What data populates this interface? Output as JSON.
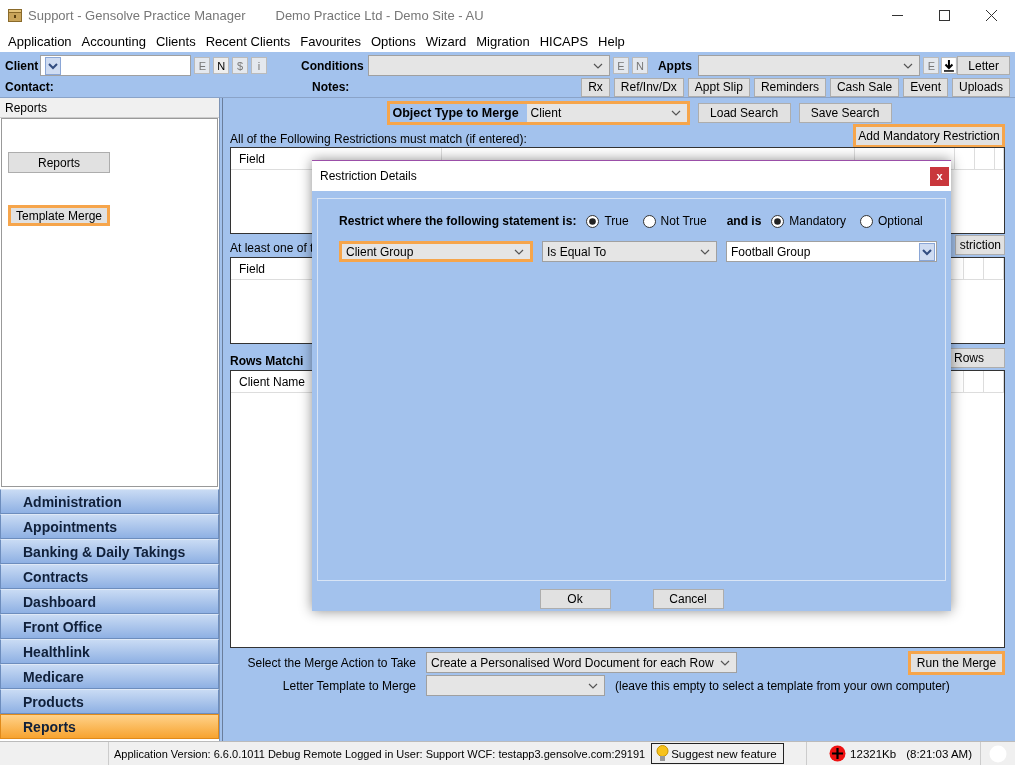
{
  "window": {
    "title": "Support - Gensolve Practice Manager",
    "subtitle": "Demo Practice Ltd - Demo Site - AU"
  },
  "menu": [
    "Application",
    "Accounting",
    "Clients",
    "Recent Clients",
    "Favourites",
    "Options",
    "Wizard",
    "Migration",
    "HICAPS",
    "Help"
  ],
  "toolbar": {
    "client_label": "Client",
    "client_buttons": [
      {
        "label": "E",
        "disabled": true
      },
      {
        "label": "N",
        "disabled": false
      },
      {
        "label": "$",
        "disabled": true
      },
      {
        "label": "i",
        "disabled": true
      }
    ],
    "conditions_label": "Conditions",
    "conditions_buttons": [
      {
        "label": "E",
        "disabled": true
      },
      {
        "label": "N",
        "disabled": true
      }
    ],
    "appts_label": "Appts",
    "appts_buttons": [
      {
        "label": "E",
        "disabled": true
      }
    ],
    "letter": "Letter",
    "contact_label": "Contact:",
    "notes_label": "Notes:",
    "actions": [
      "Rx",
      "Ref/Inv/Dx",
      "Appt Slip",
      "Reminders",
      "Cash Sale",
      "Event",
      "Uploads"
    ]
  },
  "sidebar": {
    "header": "Reports",
    "buttons": [
      {
        "label": "Reports",
        "highlighted": false
      },
      {
        "label": "Template Merge",
        "highlighted": true
      }
    ],
    "nav": [
      {
        "label": "Administration",
        "selected": false
      },
      {
        "label": "Appointments",
        "selected": false
      },
      {
        "label": "Banking & Daily Takings",
        "selected": false
      },
      {
        "label": "Contracts",
        "selected": false
      },
      {
        "label": "Dashboard",
        "selected": false
      },
      {
        "label": "Front Office",
        "selected": false
      },
      {
        "label": "Healthlink",
        "selected": false
      },
      {
        "label": "Medicare",
        "selected": false
      },
      {
        "label": "Products",
        "selected": false
      },
      {
        "label": "Reports",
        "selected": true
      }
    ]
  },
  "merge": {
    "object_type": {
      "label": "Object Type to Merge",
      "value": "Client",
      "highlighted": true
    },
    "load_search": "Load Search",
    "save_search": "Save Search",
    "add_mandatory": {
      "label": "Add Mandatory Restriction",
      "highlighted": true
    },
    "mandatory_caption": "All of the Following Restrictions must match (if entered):",
    "mandatory_columns": [
      "Field"
    ],
    "optional_caption": "At least one of t",
    "optional_button": "striction",
    "optional_columns": [
      "Field"
    ],
    "rows_caption": "Rows Matchi",
    "rows_button": "Rows",
    "rows_columns": [
      "Client Name"
    ],
    "action_label": "Select the Merge Action to Take",
    "action_value": "Create a Personalised Word Document for each Row",
    "run": {
      "label": "Run the Merge",
      "highlighted": true
    },
    "template_label": "Letter Template to Merge",
    "template_hint": "(leave this empty to select a template from your own computer)"
  },
  "dialog": {
    "title": "Restriction Details",
    "close": "x",
    "statement_label": "Restrict where the following statement is:",
    "truth_options": [
      {
        "label": "True",
        "selected": true
      },
      {
        "label": "Not True",
        "selected": false
      }
    ],
    "and_is_label": "and is",
    "requirement_options": [
      {
        "label": "Mandatory",
        "selected": true
      },
      {
        "label": "Optional",
        "selected": false
      }
    ],
    "field": {
      "value": "Client Group",
      "highlighted": true
    },
    "operator": {
      "value": "Is Equal To"
    },
    "value_field": {
      "value": "Football Group"
    },
    "buttons": [
      "Ok",
      "Cancel"
    ]
  },
  "status_bar": {
    "info": "Application Version: 6.6.0.1011 Debug Remote  Logged in User: Support WCF: testapp3.gensolve.com:29191",
    "suggest": "Suggest new feature",
    "memory": "12321Kb",
    "time": "(8:21:03 AM)"
  }
}
